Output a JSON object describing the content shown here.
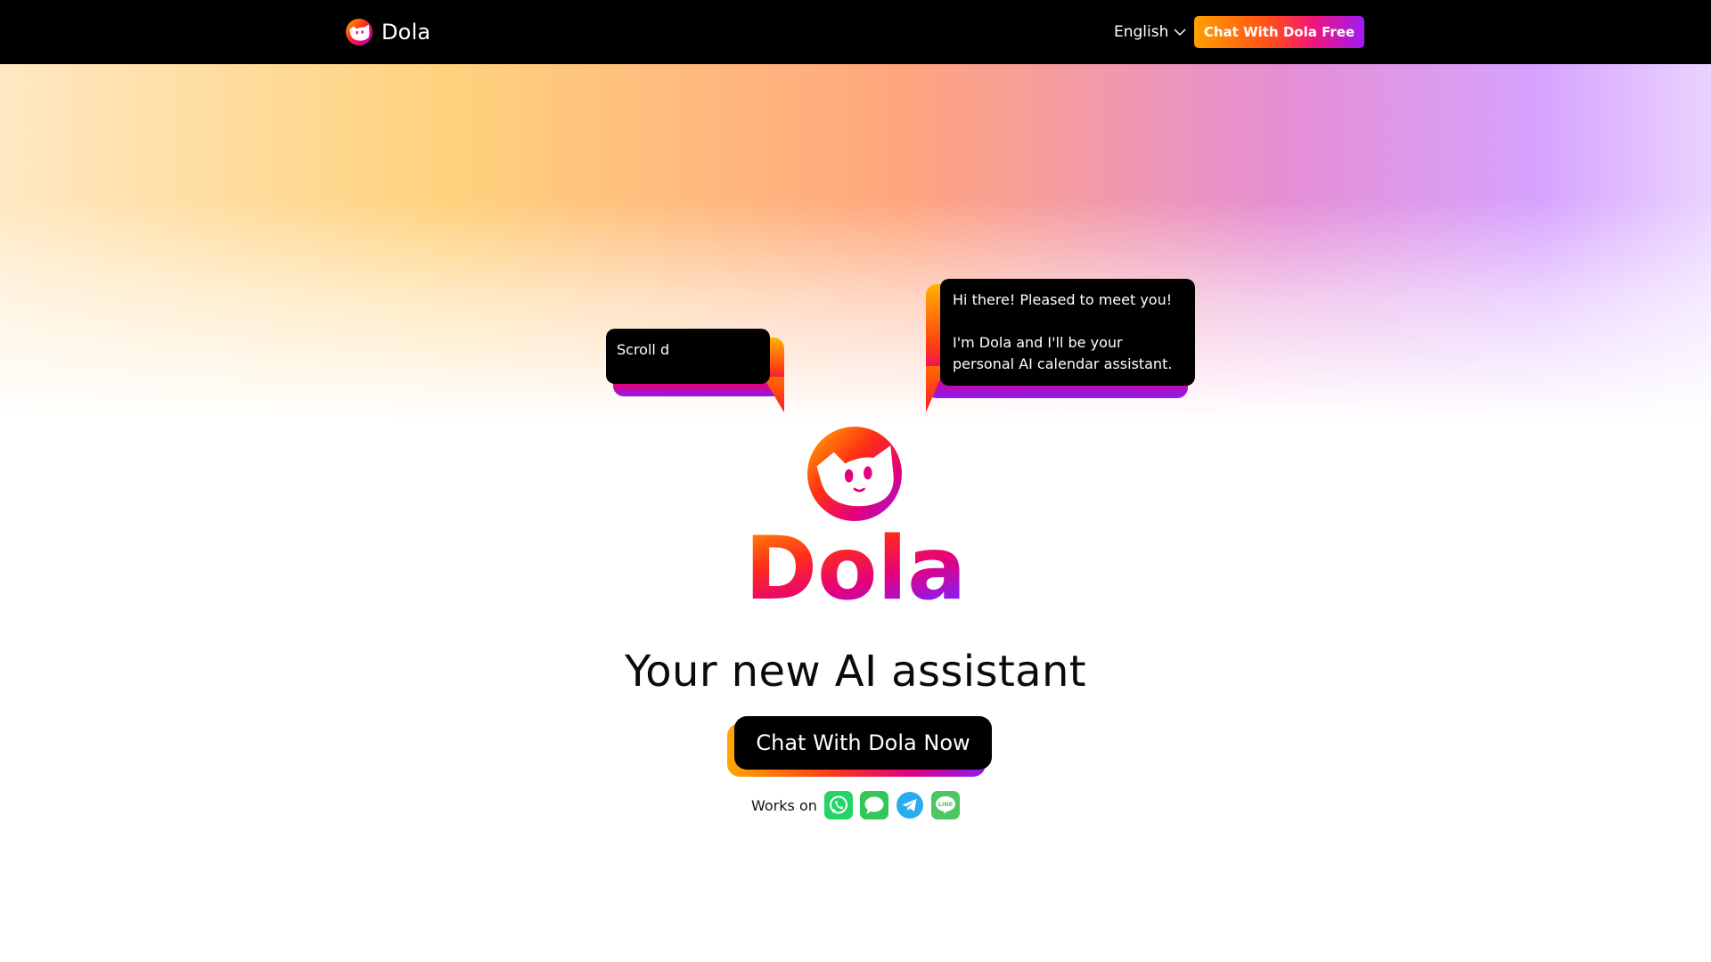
{
  "nav": {
    "brand": "Dola",
    "language": "English",
    "cta_label": "Chat With Dola Free"
  },
  "bubbles": {
    "left": {
      "text": "Scroll d"
    },
    "right": {
      "line1": "Hi there! Pleased to meet you!",
      "line2": "I'm Dola and I'll be your",
      "line3": "personal AI calendar assistant."
    }
  },
  "hero": {
    "wordmark": "Dola",
    "headline": "Your new AI assistant",
    "cta_label": "Chat With Dola Now",
    "works_on_label": "Works on",
    "platforms": [
      {
        "name": "WhatsApp",
        "icon": "whatsapp-icon",
        "color": "#25D366"
      },
      {
        "name": "iMessage",
        "icon": "imessage-icon",
        "color": "#33C759"
      },
      {
        "name": "Telegram",
        "icon": "telegram-icon",
        "color": "#2AABEE"
      },
      {
        "name": "LINE",
        "icon": "line-icon",
        "color": "#4CC764"
      }
    ]
  },
  "colors": {
    "brand_orange": "#FF7A00",
    "brand_red": "#FF1A3C",
    "brand_magenta": "#E4007C",
    "brand_purple": "#8A1CF2"
  }
}
